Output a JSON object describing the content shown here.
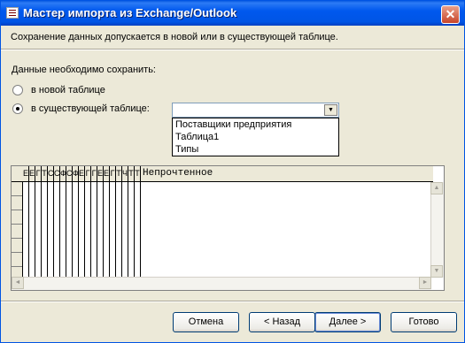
{
  "window": {
    "title": "Мастер импорта из Exchange/Outlook",
    "close_glyph": "✕"
  },
  "description": "Сохранение данных допускается в новой или в существующей таблице.",
  "save_prompt": "Данные необходимо сохранить:",
  "options": [
    {
      "label": "в новой таблице",
      "selected": false
    },
    {
      "label": "в существующей таблице:",
      "selected": true
    }
  ],
  "table_combo": {
    "value": "",
    "arrow": "▼",
    "options": [
      "Поставщики предприятия",
      "Таблица1",
      "Типы"
    ]
  },
  "preview": {
    "columns": [
      "Е",
      "Е",
      "Г",
      "Т",
      "С",
      "С",
      "Ф",
      "С",
      "Ф",
      "Е",
      "Г",
      "Г",
      "Е",
      "Е",
      "Г",
      "Т",
      "Ч",
      "Т",
      "Т",
      "Непрочтенное"
    ],
    "scroll_up": "▲",
    "scroll_down": "▼",
    "scroll_left": "◄",
    "scroll_right": "►"
  },
  "buttons": {
    "cancel": "Отмена",
    "back": "< Назад",
    "next": "Далее >",
    "finish": "Готово"
  }
}
